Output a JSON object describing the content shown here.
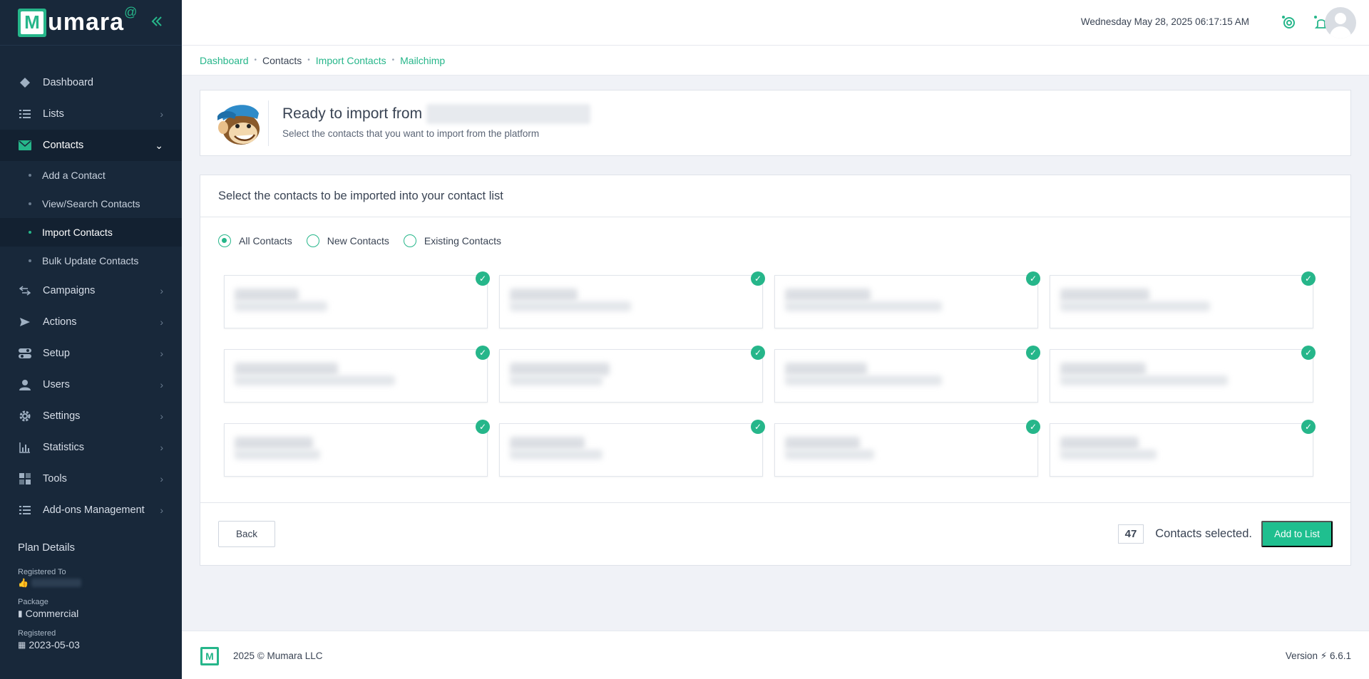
{
  "brand": {
    "name": "umara",
    "initial": "M",
    "at": "@"
  },
  "topbar": {
    "datetime": "Wednesday May 28, 2025 06:17:15 AM"
  },
  "sidebar": {
    "items": [
      {
        "label": "Dashboard",
        "icon": "diamond-icon"
      },
      {
        "label": "Lists",
        "icon": "list-icon"
      },
      {
        "label": "Contacts",
        "icon": "envelope-icon"
      },
      {
        "label": "Campaigns",
        "icon": "arrows-icon"
      },
      {
        "label": "Actions",
        "icon": "send-icon"
      },
      {
        "label": "Setup",
        "icon": "toggle-icon"
      },
      {
        "label": "Users",
        "icon": "user-icon"
      },
      {
        "label": "Settings",
        "icon": "gear-icon"
      },
      {
        "label": "Statistics",
        "icon": "bar-chart-icon"
      },
      {
        "label": "Tools",
        "icon": "grid-icon"
      },
      {
        "label": "Add-ons Management",
        "icon": "list-icon"
      }
    ],
    "contacts_sub": [
      {
        "label": "Add a Contact"
      },
      {
        "label": "View/Search Contacts"
      },
      {
        "label": "Import Contacts"
      },
      {
        "label": "Bulk Update Contacts"
      }
    ],
    "plan": {
      "title": "Plan Details",
      "registered_to_label": "Registered To",
      "package_label": "Package",
      "package_value": "Commercial",
      "registered_label": "Registered",
      "registered_value": "2023-05-03"
    }
  },
  "breadcrumb": {
    "items": [
      "Dashboard",
      "Contacts",
      "Import Contacts",
      "Mailchimp"
    ]
  },
  "header_card": {
    "title": "Ready to import from",
    "subtitle": "Select the contacts that you want to import from the platform"
  },
  "contacts_card": {
    "title": "Select the contacts to be imported into your contact list",
    "filters": [
      {
        "label": "All Contacts",
        "checked": true
      },
      {
        "label": "New Contacts",
        "checked": false
      },
      {
        "label": "Existing Contacts",
        "checked": false
      }
    ],
    "back_label": "Back",
    "selected_count": "47",
    "selected_label": "Contacts selected.",
    "add_label": "Add to List"
  },
  "footer": {
    "copyright": "2025 © Mumara LLC",
    "version_label": "Version",
    "version": "6.6.1"
  },
  "colors": {
    "accent": "#26b68a",
    "sidebar_bg": "#18283a"
  }
}
